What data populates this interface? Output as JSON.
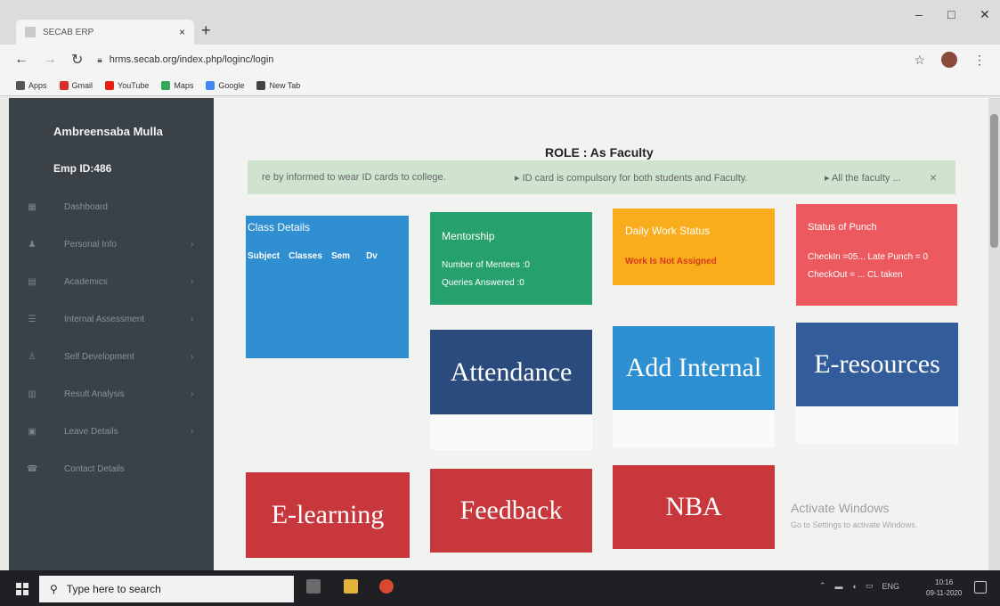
{
  "browser": {
    "tab_title": "SECAB ERP",
    "tab_close": "×",
    "new_tab": "+",
    "url": "hrms.secab.org/index.php/loginc/login",
    "star": "☆",
    "menu": "⋮",
    "bookmarks": [
      {
        "label": "Apps",
        "color": "#555555"
      },
      {
        "label": "Gmail",
        "color": "#d93025"
      },
      {
        "label": "YouTube",
        "color": "#e62117"
      },
      {
        "label": "Maps",
        "color": "#34a853"
      },
      {
        "label": "Google",
        "color": "#4285f4"
      },
      {
        "label": "New Tab",
        "color": "#444444"
      }
    ]
  },
  "sidebar": {
    "user_name": "Ambreensaba Mulla",
    "emp_id": "Emp ID:486",
    "items": [
      {
        "label": "Dashboard",
        "icon": "dashboard-icon",
        "has_arrow": false
      },
      {
        "label": "Personal Info",
        "icon": "user-icon",
        "has_arrow": true
      },
      {
        "label": "Academics",
        "icon": "book-icon",
        "has_arrow": true
      },
      {
        "label": "Internal Assessment",
        "icon": "list-icon",
        "has_arrow": true
      },
      {
        "label": "Self Development",
        "icon": "person-icon",
        "has_arrow": true
      },
      {
        "label": "Result Analysis",
        "icon": "chart-icon",
        "has_arrow": true
      },
      {
        "label": "Leave Details",
        "icon": "calendar-icon",
        "has_arrow": true
      },
      {
        "label": "Contact Details",
        "icon": "phone-icon",
        "has_arrow": false
      }
    ]
  },
  "main": {
    "role": "ROLE : As Faculty",
    "notice": {
      "item1": "re by informed to wear ID cards to college.",
      "item2": "▸ ID card is compulsory for both students and Faculty.",
      "item3": "▸ All the faculty ...",
      "close": "×"
    },
    "class_details": {
      "title": "Class Details",
      "headers": [
        "Subject",
        "Classes",
        "Sem",
        "Dv"
      ],
      "color": "#2f8fd0"
    },
    "mentorship": {
      "title": "Mentorship",
      "line1": "Number of Mentees :0",
      "line2": "Queries Answered :0",
      "color": "#26a06d"
    },
    "daily_work": {
      "title": "Daily Work Status",
      "status": "Work Is Not Assigned",
      "color": "#f9ac1c",
      "status_color": "#d63a1e"
    },
    "punch": {
      "title": "Status of Punch",
      "line1": "CheckIn =05... Late Punch = 0",
      "line2": "CheckOut = ...  CL taken",
      "color": "#ec5a5f"
    },
    "tiles": [
      {
        "label": "Attendance",
        "color": "#2b4a7e"
      },
      {
        "label": "Add Internal",
        "color": "#2e8fd2"
      },
      {
        "label": "E-resources",
        "color": "#325d9a"
      },
      {
        "label": "E-learning",
        "color": "#c8373b"
      },
      {
        "label": "Feedback",
        "color": "#c8373b"
      },
      {
        "label": "NBA",
        "color": "#c8373b"
      }
    ],
    "watermark_title": "Activate Windows",
    "watermark_sub": "Go to Settings to activate Windows."
  },
  "taskbar": {
    "search_placeholder": "Type here to search",
    "tray_lang": "ENG",
    "clock_time": "10:16",
    "clock_date": "09-11-2020"
  }
}
